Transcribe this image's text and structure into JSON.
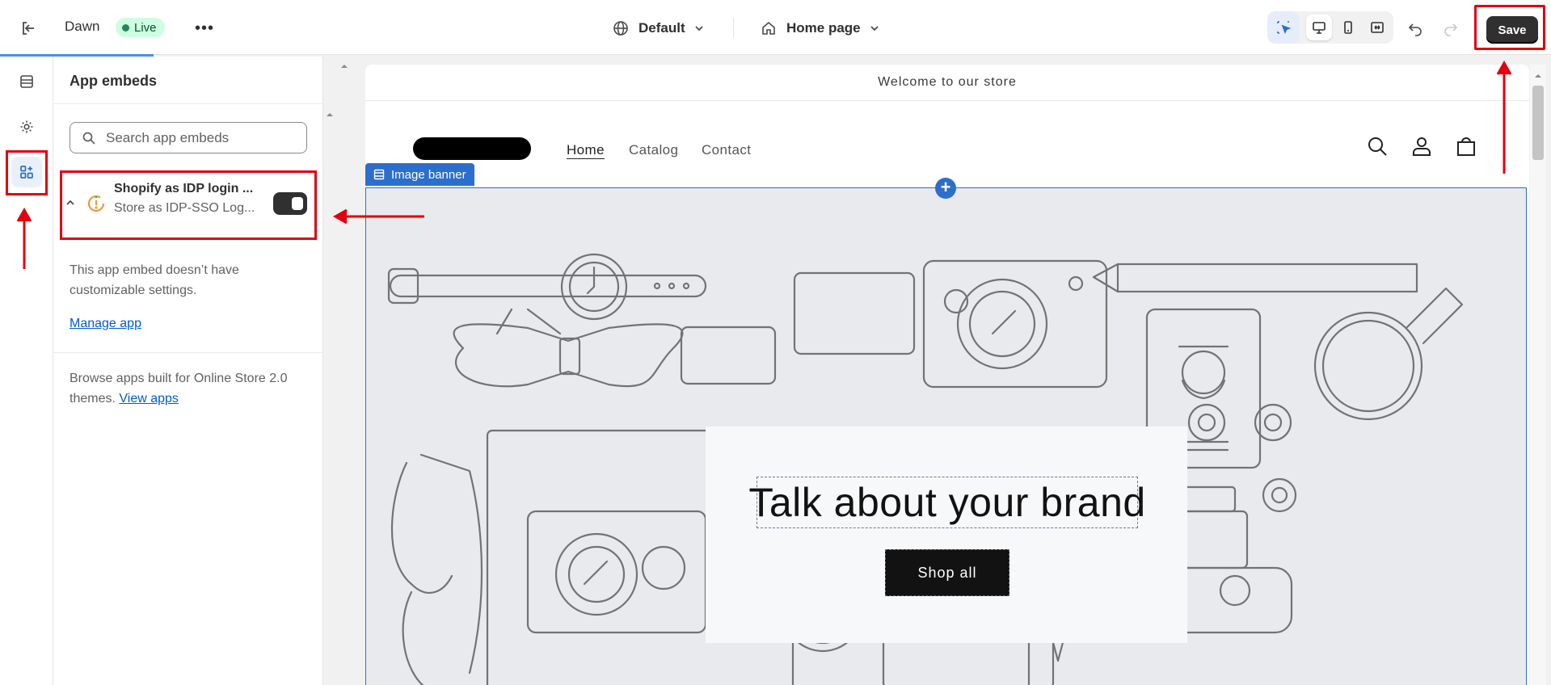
{
  "topbar": {
    "theme_name": "Dawn",
    "status_badge": "Live",
    "more_label": "•••",
    "language_selector": "Default",
    "page_selector": "Home page",
    "save_label": "Save"
  },
  "sidebar_panel": {
    "title": "App embeds",
    "search_placeholder": "Search app embeds",
    "embed": {
      "name": "Shopify as IDP login ...",
      "subtitle": "Store as IDP-SSO Log...",
      "enabled": true
    },
    "note": "This app embed doesn’t have customizable settings.",
    "manage_link": "Manage app",
    "browse_text": "Browse apps built for Online Store 2.0 themes.",
    "browse_link": "View apps"
  },
  "preview": {
    "announcement": "Welcome to our store",
    "nav": [
      "Home",
      "Catalog",
      "Contact"
    ],
    "section_tag": "Image banner",
    "add_section": "+",
    "banner_heading": "Talk about your brand",
    "banner_button": "Shop all"
  },
  "colors": {
    "annotation_red": "#e3000f",
    "accent_blue": "#2c6ecb",
    "link_blue": "#005bd3",
    "save_bg": "#303030"
  }
}
